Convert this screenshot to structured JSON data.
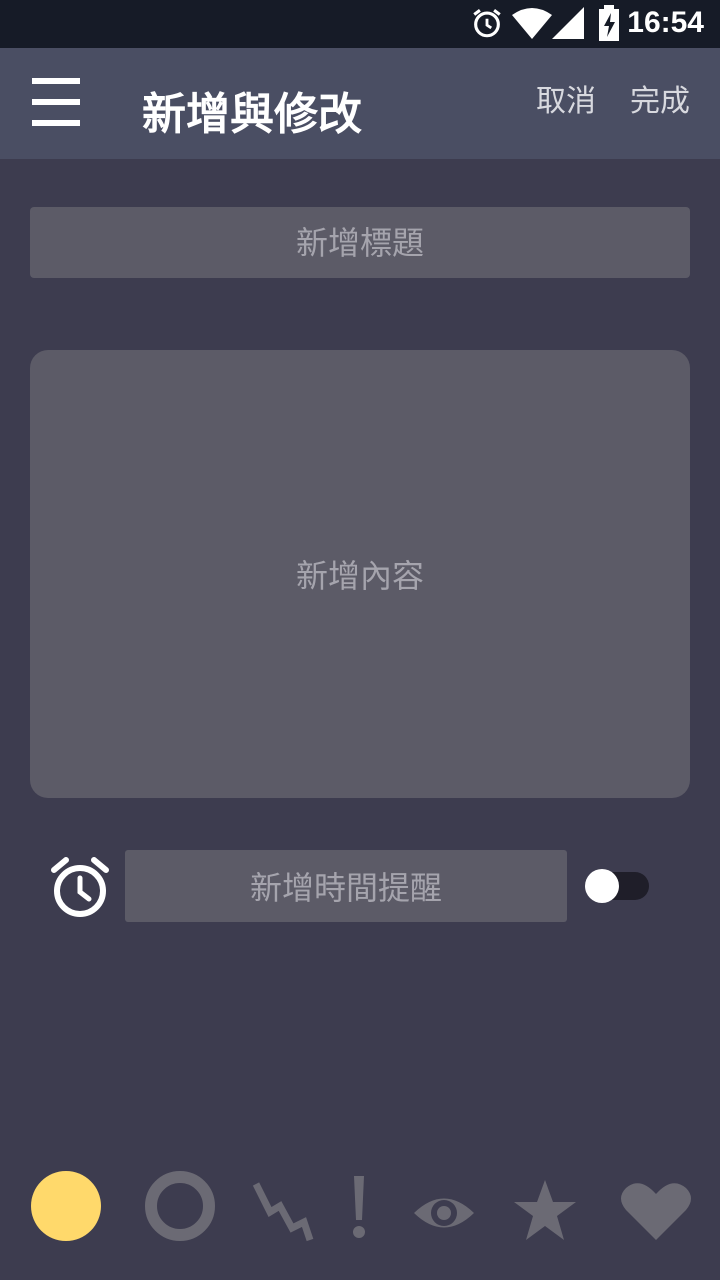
{
  "status_bar": {
    "time": "16:54",
    "icons": [
      "alarm-icon",
      "wifi-icon",
      "signal-icon",
      "battery-charging-icon"
    ]
  },
  "app_bar": {
    "menu_icon": "hamburger-menu-icon",
    "title": "新增與修改",
    "cancel_label": "取消",
    "done_label": "完成"
  },
  "form": {
    "title_placeholder": "新增標題",
    "content_placeholder": "新增內容",
    "reminder_placeholder": "新增時間提醒",
    "reminder_enabled": false
  },
  "icon_picker": {
    "items": [
      {
        "name": "filled-circle-icon",
        "color": "#ffd96b",
        "selected": true
      },
      {
        "name": "ring-icon",
        "color": "#6b6a74",
        "selected": false
      },
      {
        "name": "lightning-icon",
        "color": "#6b6a74",
        "selected": false
      },
      {
        "name": "exclamation-icon",
        "color": "#6b6a74",
        "selected": false
      },
      {
        "name": "eye-icon",
        "color": "#6b6a74",
        "selected": false
      },
      {
        "name": "star-icon",
        "color": "#6b6a74",
        "selected": false
      },
      {
        "name": "heart-icon",
        "color": "#6b6a74",
        "selected": false
      }
    ]
  },
  "colors": {
    "background": "#3d3c4f",
    "app_bar": "#4a4e63",
    "status_bar": "#161b27",
    "input_fill": "#5c5b67",
    "placeholder_text": "#a5a4ad",
    "accent_yellow": "#ffd96b",
    "icon_muted": "#6b6a74"
  }
}
